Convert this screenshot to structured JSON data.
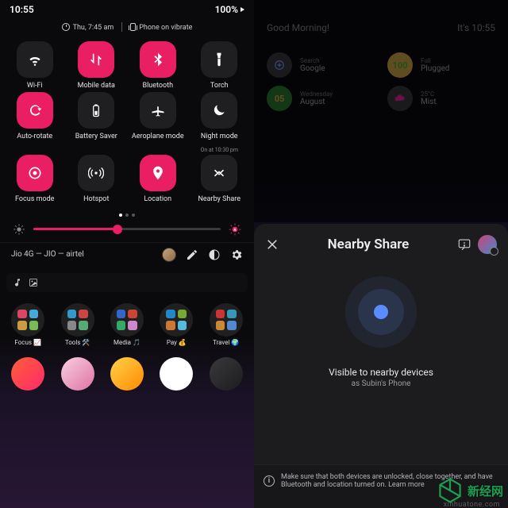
{
  "status": {
    "time": "10:55",
    "battery": "100%"
  },
  "dateline": {
    "alarm": "Thu, 7:45 am",
    "ringer": "Phone on vibrate"
  },
  "tiles": [
    {
      "id": "wifi",
      "label": "Wi-Fi",
      "on": false,
      "icon": "wifi"
    },
    {
      "id": "mobiledata",
      "label": "Mobile data",
      "on": true,
      "icon": "data"
    },
    {
      "id": "bluetooth",
      "label": "Bluetooth",
      "on": true,
      "icon": "bt"
    },
    {
      "id": "torch",
      "label": "Torch",
      "on": false,
      "icon": "torch"
    },
    {
      "id": "autorotate",
      "label": "Auto-rotate",
      "on": true,
      "icon": "rotate"
    },
    {
      "id": "battsaver",
      "label": "Battery Saver",
      "on": false,
      "icon": "batt"
    },
    {
      "id": "aeroplane",
      "label": "Aeroplane mode",
      "on": false,
      "icon": "plane"
    },
    {
      "id": "nightmode",
      "label": "Night mode",
      "sub": "On at 10:30 pm",
      "on": false,
      "icon": "moon"
    },
    {
      "id": "focusmode",
      "label": "Focus mode",
      "on": true,
      "icon": "focus"
    },
    {
      "id": "hotspot",
      "label": "Hotspot",
      "on": false,
      "icon": "hotspot"
    },
    {
      "id": "location",
      "label": "Location",
      "on": true,
      "icon": "pin"
    },
    {
      "id": "nearby",
      "label": "Nearby Share",
      "on": false,
      "icon": "nearby"
    }
  ],
  "brightness": {
    "percent": 45
  },
  "carrier": "Jio 4G — JIO — airtel",
  "dock": [
    {
      "label": "Focus 📈",
      "colors": [
        "#d46",
        "#4ad",
        "#c94",
        "#7b5"
      ]
    },
    {
      "label": "Tools 🛠️",
      "colors": [
        "#39c",
        "#c44",
        "#888",
        "#5a7"
      ]
    },
    {
      "label": "Media 🎵",
      "colors": [
        "#36c",
        "#c43",
        "#3a6",
        "#c8c"
      ]
    },
    {
      "label": "Pay 💰",
      "colors": [
        "#28c",
        "#7a3",
        "#c73",
        "#5bd"
      ]
    },
    {
      "label": "Travel 🌍",
      "colors": [
        "#c33",
        "#39b",
        "#c83",
        "#58c"
      ]
    }
  ],
  "apps_row": [
    {
      "bg": "linear-gradient(135deg,#ff5e3a,#ff2a68)"
    },
    {
      "bg": "linear-gradient(135deg,#f7d0e0,#e072a4)"
    },
    {
      "bg": "linear-gradient(135deg,#ffd24a,#ff8a00)"
    },
    {
      "bg": "#ffffff"
    },
    {
      "bg": "linear-gradient(135deg,#3a3a3c,#1c1c1e)"
    }
  ],
  "home": {
    "greeting": "Good Morning!",
    "clock": "It's 10:55",
    "widgets": [
      {
        "circle_text": "",
        "circle_bg": "#3a3a40",
        "circle_fg": "#8aa0ff",
        "icon": "g",
        "line1": "Search",
        "line2": "Google"
      },
      {
        "circle_text": "100",
        "circle_bg": "#d6a84a",
        "circle_fg": "#5a3",
        "line1": "Full",
        "line2": "Plugged"
      },
      {
        "circle_text": "05",
        "circle_bg": "#2e7d32",
        "circle_fg": "#d6a84a",
        "line1": "Wednesday",
        "line2": "August"
      },
      {
        "circle_text": "",
        "circle_bg": "#3a3a40",
        "circle_fg": "#e29",
        "icon": "cloud",
        "line1": "25°C",
        "line2": "Mist"
      }
    ]
  },
  "nearby": {
    "title": "Nearby Share",
    "visible_line": "Visible to nearby devices",
    "visible_sub": "as Subin's Phone",
    "info": "Make sure that both devices are unlocked, close together, and have Bluetooth and location turned on. Learn more"
  },
  "watermark": {
    "brand": "新经网",
    "url": "xinhuatone.com"
  }
}
